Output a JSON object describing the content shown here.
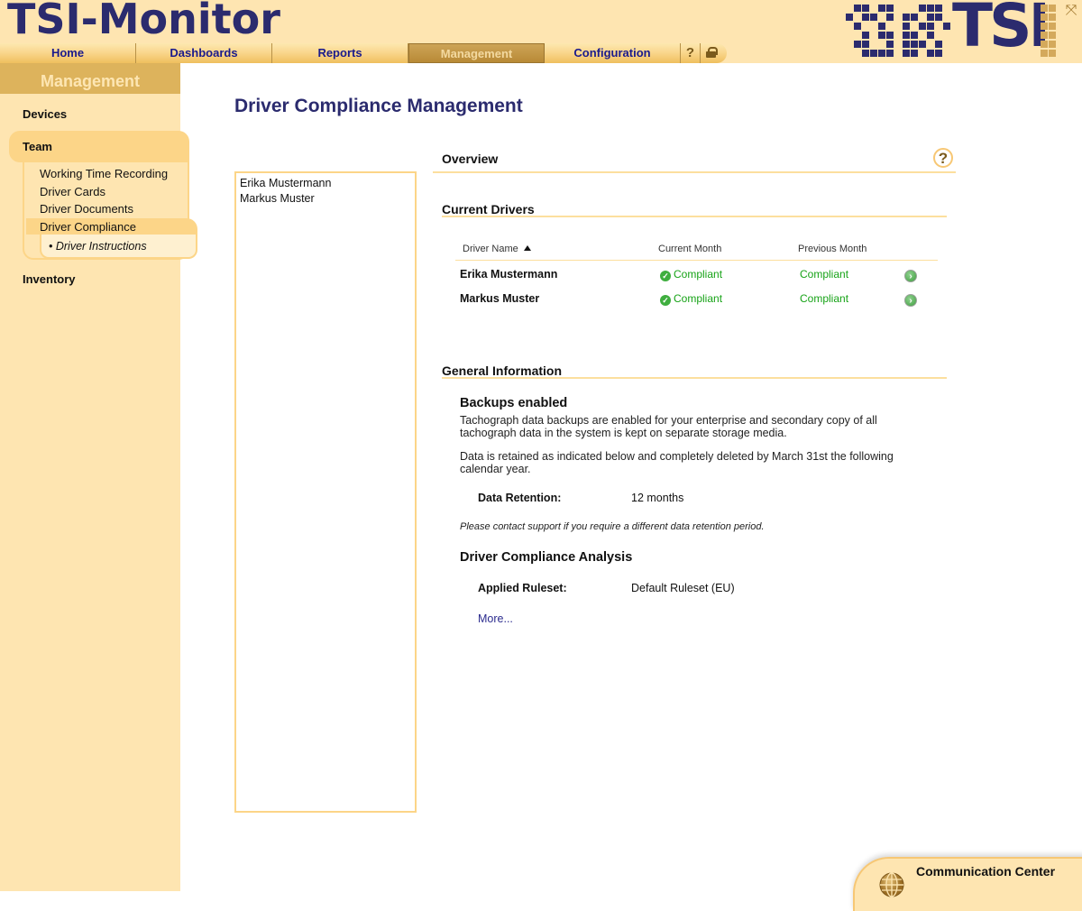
{
  "header": {
    "app_title": "TSI-Monitor",
    "logo_text": "TSI",
    "nav_tabs": [
      {
        "label": "Home",
        "active": false
      },
      {
        "label": "Dashboards",
        "active": false
      },
      {
        "label": "Reports",
        "active": false
      },
      {
        "label": "Management",
        "active": true
      },
      {
        "label": "Configuration",
        "active": false
      }
    ],
    "help_glyph": "?"
  },
  "sidebar": {
    "title": "Management",
    "items": [
      {
        "label": "Devices"
      },
      {
        "label": "Team",
        "expanded": true,
        "children": [
          {
            "label": "Working Time Recording"
          },
          {
            "label": "Driver Cards"
          },
          {
            "label": "Driver Documents"
          },
          {
            "label": "Driver Compliance",
            "selected": true,
            "children": [
              {
                "label": "Driver Instructions"
              }
            ]
          }
        ]
      },
      {
        "label": "Inventory"
      }
    ]
  },
  "main": {
    "page_title": "Driver Compliance Management",
    "driver_list": [
      "Erika Mustermann",
      "Markus Muster"
    ],
    "overview": {
      "title": "Overview",
      "help_glyph": "?"
    },
    "current_drivers": {
      "title": "Current Drivers",
      "columns": [
        "Driver Name",
        "Current Month",
        "Previous Month"
      ],
      "sort": {
        "column": "Driver Name",
        "direction": "ascending"
      },
      "rows": [
        {
          "name": "Erika Mustermann",
          "current": "Compliant",
          "previous": "Compliant"
        },
        {
          "name": "Markus Muster",
          "current": "Compliant",
          "previous": "Compliant"
        }
      ]
    },
    "general_information": {
      "title": "General Information",
      "backups_title": "Backups enabled",
      "backups_text": "Tachograph data backups are enabled for your enterprise and secondary copy of all tachograph data in the system is kept on separate storage media.",
      "retention_text": "Data is retained as indicated below and completely deleted by March 31st the following calendar year.",
      "retention_label": "Data Retention:",
      "retention_value": "12 months",
      "support_note": "Please contact support if you require a different data retention period.",
      "analysis_title": "Driver Compliance Analysis",
      "ruleset_label": "Applied Ruleset:",
      "ruleset_value": "Default Ruleset (EU)",
      "more_link": "More..."
    }
  },
  "communication_center": {
    "label": "Communication Center"
  },
  "colors": {
    "brand_navy": "#2b2b6e",
    "sidebar_bg": "#fee5b1",
    "accent_gold": "#fcd588",
    "compliant_green": "#17a317"
  }
}
